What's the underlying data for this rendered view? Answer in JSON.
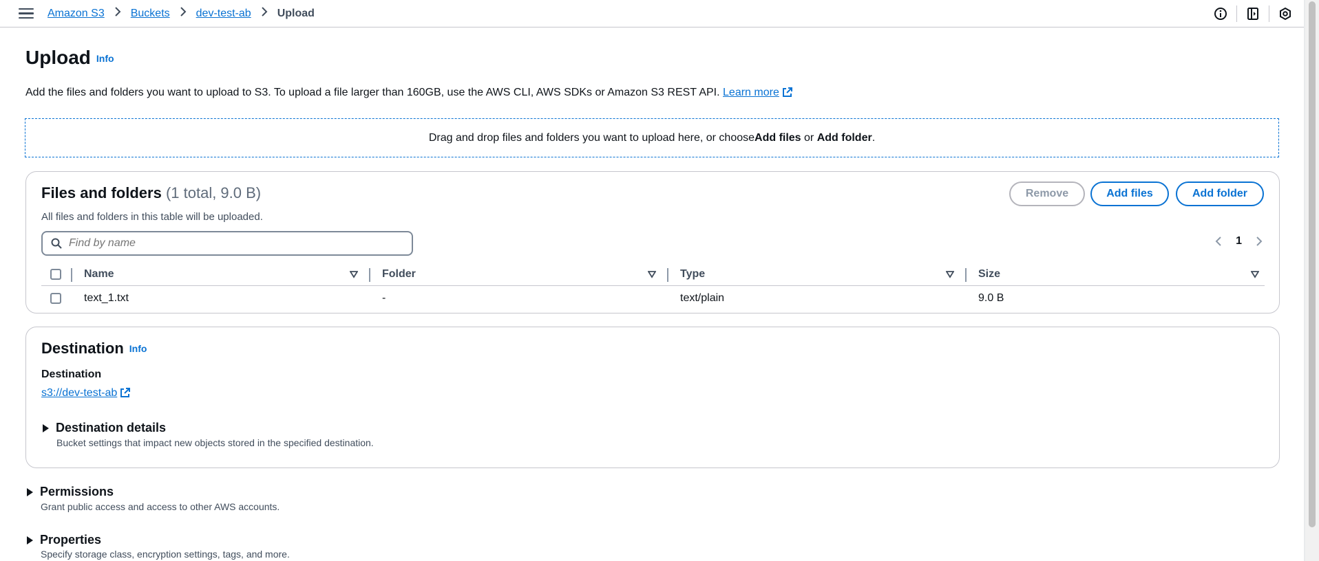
{
  "breadcrumbs": [
    {
      "label": "Amazon S3"
    },
    {
      "label": "Buckets"
    },
    {
      "label": "dev-test-ab"
    },
    {
      "label": "Upload"
    }
  ],
  "header": {
    "title": "Upload",
    "info": "Info",
    "description": "Add the files and folders you want to upload to S3. To upload a file larger than 160GB, use the AWS CLI, AWS SDKs or Amazon S3 REST API.",
    "learn_more": "Learn more"
  },
  "dropzone": {
    "text_before": "Drag and drop files and folders you want to upload here, or choose ",
    "add_files": "Add files",
    "or": " or ",
    "add_folder": "Add folder",
    "end": "."
  },
  "files": {
    "title": "Files and folders",
    "counter": "(1 total, 9.0 B)",
    "subtitle": "All files and folders in this table will be uploaded.",
    "remove_label": "Remove",
    "add_files_label": "Add files",
    "add_folder_label": "Add folder",
    "search_placeholder": "Find by name",
    "page": "1",
    "columns": [
      "Name",
      "Folder",
      "Type",
      "Size"
    ],
    "rows": [
      {
        "name": "text_1.txt",
        "folder": "-",
        "type": "text/plain",
        "size": "9.0 B"
      }
    ]
  },
  "destination": {
    "title": "Destination",
    "info": "Info",
    "label": "Destination",
    "link": "s3://dev-test-ab",
    "details_title": "Destination details",
    "details_desc": "Bucket settings that impact new objects stored in the specified destination."
  },
  "permissions": {
    "title": "Permissions",
    "desc": "Grant public access and access to other AWS accounts."
  },
  "properties": {
    "title": "Properties",
    "desc": "Specify storage class, encryption settings, tags, and more."
  }
}
